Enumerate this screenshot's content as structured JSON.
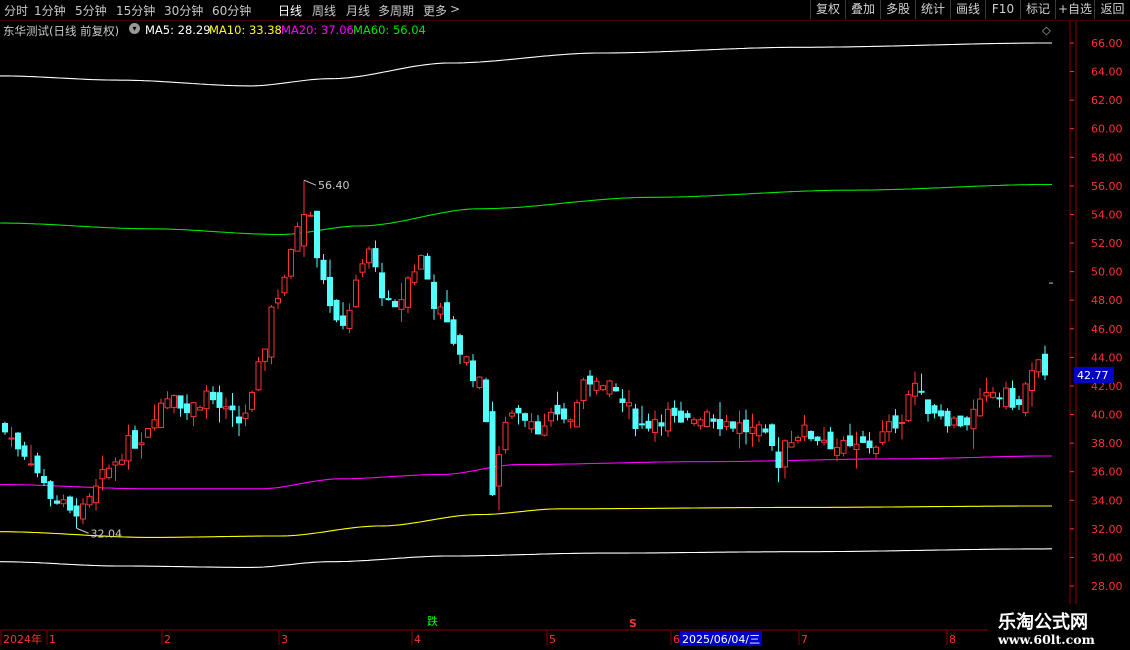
{
  "toolbar": {
    "periods": [
      "分时",
      "1分钟",
      "5分钟",
      "15分钟",
      "30分钟",
      "60分钟",
      "日线",
      "周线",
      "月线",
      "多周期",
      "更多"
    ],
    "active_period": "日线",
    "more_arrow": ">",
    "buttons": [
      "复权",
      "叠加",
      "多股",
      "统计",
      "画线",
      "F10",
      "标记",
      "+自选",
      "返回"
    ]
  },
  "info": {
    "title": "东华测试(日线 前复权)",
    "ma5": "MA5: 28.29",
    "ma10": "MA10: 33.38",
    "ma20": "MA20: 37.06",
    "ma60": "MA60: 56.04",
    "diamond": "◇"
  },
  "colors": {
    "up": "#ff3232",
    "down": "#54ffff",
    "ma5": "#ffffff",
    "ma10": "#ffff00",
    "ma20": "#ff00ff",
    "ma60": "#00e600",
    "axis": "#ff3232",
    "price_label_bg": "#0000c8"
  },
  "price_axis": {
    "ticks": [
      "66.00",
      "64.00",
      "62.00",
      "60.00",
      "58.00",
      "56.00",
      "54.00",
      "52.00",
      "50.00",
      "48.00",
      "46.00",
      "44.00",
      "42.00",
      "40.00",
      "38.00",
      "36.00",
      "34.00",
      "32.00",
      "30.00",
      "28.00"
    ],
    "current_price": "42.77"
  },
  "annotations": {
    "high": "56.40",
    "low": "32.04",
    "signal_fall": "跌",
    "signal_s": "S"
  },
  "time_axis": {
    "labels": [
      "2024年",
      "1",
      "2",
      "3",
      "4",
      "5",
      "6",
      "2025/06/04/三",
      "7",
      "8"
    ],
    "highlighted": "2025/06/04/三"
  },
  "watermark": {
    "line1": "乐淘公式网",
    "line2": "www.60lt.com"
  },
  "chart_data": {
    "type": "candlestick",
    "ylim": [
      27.0,
      67.0
    ],
    "indicators": [
      "MA5",
      "MA10",
      "MA20",
      "MA60"
    ],
    "high": 56.4,
    "low": 32.04,
    "last": 42.77,
    "close_path": [
      [
        0,
        38.8
      ],
      [
        4,
        37.0
      ],
      [
        6,
        35.0
      ],
      [
        9,
        33.5
      ],
      [
        11,
        32.4
      ],
      [
        13,
        33.8
      ],
      [
        15,
        35.5
      ],
      [
        18,
        37.5
      ],
      [
        21,
        38.5
      ],
      [
        23,
        40.3
      ],
      [
        26,
        41.8
      ],
      [
        28,
        40.2
      ],
      [
        31,
        41.5
      ],
      [
        34,
        40.0
      ],
      [
        36,
        39.5
      ],
      [
        38,
        41.0
      ],
      [
        40,
        45.0
      ],
      [
        41,
        47.5
      ],
      [
        42,
        48.5
      ],
      [
        44,
        51.0
      ],
      [
        45,
        53.5
      ],
      [
        46,
        56.0
      ],
      [
        47,
        54.5
      ],
      [
        48,
        51.5
      ],
      [
        50,
        48.0
      ],
      [
        51,
        46.0
      ],
      [
        53,
        47.5
      ],
      [
        54,
        49.0
      ],
      [
        56,
        51.5
      ],
      [
        57,
        50.0
      ],
      [
        59,
        47.5
      ],
      [
        60,
        47.0
      ],
      [
        62,
        49.5
      ],
      [
        64,
        51.0
      ],
      [
        66,
        48.0
      ],
      [
        68,
        46.0
      ],
      [
        70,
        44.5
      ],
      [
        72,
        43.0
      ],
      [
        73,
        42.0
      ],
      [
        74,
        40.0
      ],
      [
        75,
        35.2
      ],
      [
        76,
        37.5
      ],
      [
        77,
        39.8
      ],
      [
        79,
        40.5
      ],
      [
        81,
        39.8
      ],
      [
        83,
        38.8
      ],
      [
        85,
        40.2
      ],
      [
        87,
        39.5
      ],
      [
        88,
        41.0
      ],
      [
        90,
        42.5
      ],
      [
        91,
        42.9
      ],
      [
        92,
        41.8
      ],
      [
        94,
        41.5
      ],
      [
        96,
        40.2
      ],
      [
        98,
        39.2
      ],
      [
        100,
        39.8
      ],
      [
        102,
        40.0
      ],
      [
        104,
        39.0
      ],
      [
        106,
        39.8
      ],
      [
        108,
        40.4
      ],
      [
        110,
        39.6
      ],
      [
        112,
        39.4
      ],
      [
        114,
        39.0
      ],
      [
        116,
        38.6
      ],
      [
        118,
        37.6
      ],
      [
        119,
        36.8
      ],
      [
        120,
        38.2
      ],
      [
        122,
        38.8
      ],
      [
        124,
        38.6
      ],
      [
        126,
        38.4
      ],
      [
        128,
        37.8
      ],
      [
        130,
        37.4
      ],
      [
        132,
        37.8
      ],
      [
        134,
        38.0
      ],
      [
        136,
        39.0
      ],
      [
        138,
        40.0
      ],
      [
        139,
        41.5
      ],
      [
        140,
        42.2
      ],
      [
        141,
        41.0
      ],
      [
        142,
        40.6
      ],
      [
        144,
        40.2
      ],
      [
        146,
        39.5
      ],
      [
        148,
        39.6
      ],
      [
        150,
        40.5
      ],
      [
        152,
        41.5
      ],
      [
        154,
        41.2
      ],
      [
        155,
        41.0
      ],
      [
        156,
        40.5
      ],
      [
        157,
        42.0
      ],
      [
        158,
        42.8
      ],
      [
        159,
        43.3
      ],
      [
        160,
        42.77
      ]
    ],
    "ma_lines_note": "MA5 white, MA10 yellow, MA20 magenta, MA60 green"
  }
}
